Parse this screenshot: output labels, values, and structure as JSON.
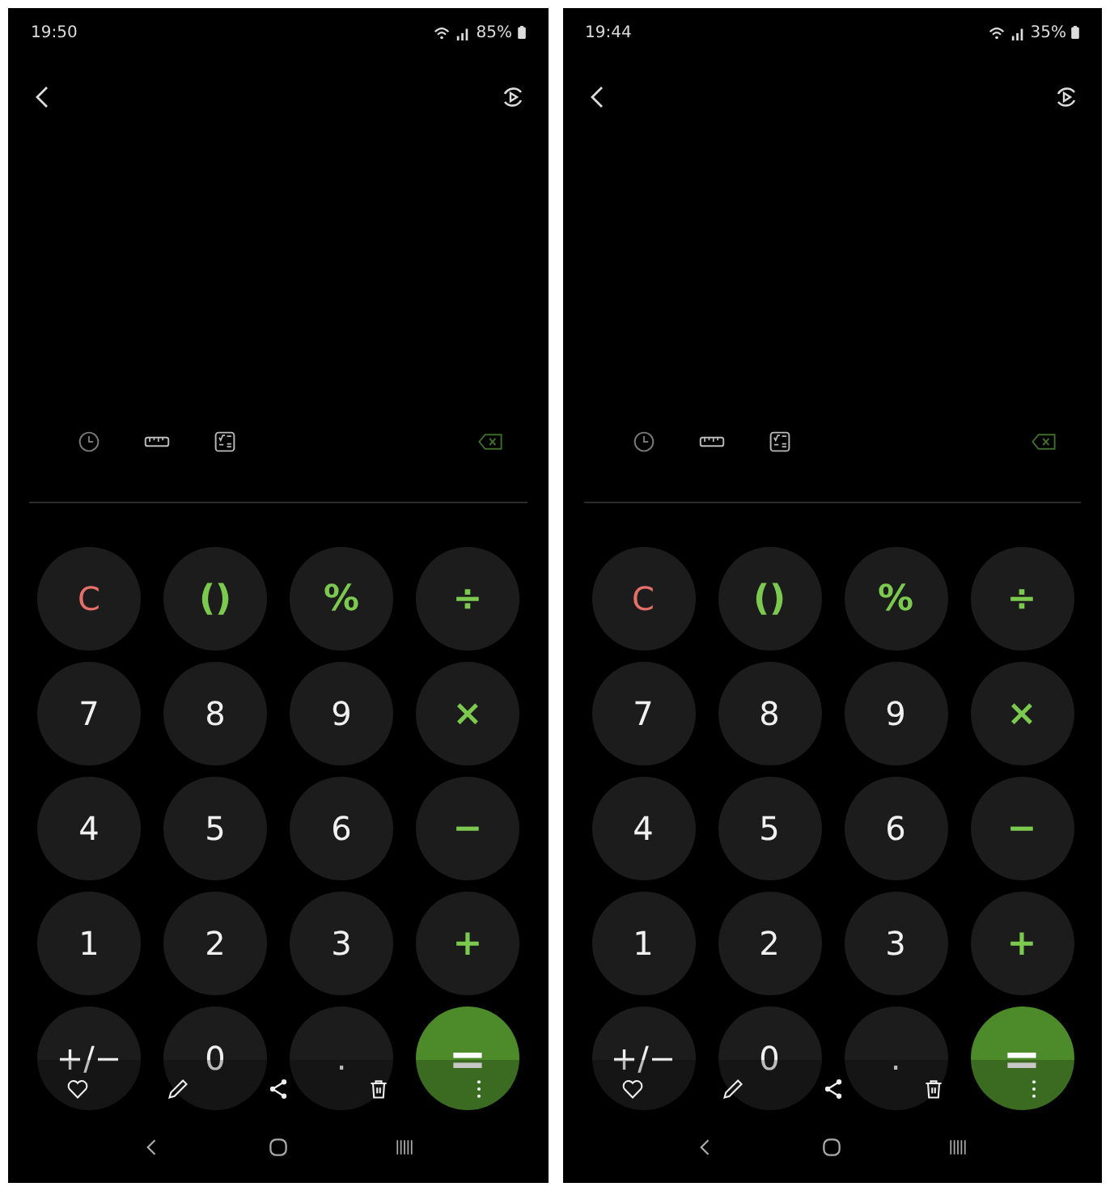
{
  "screens": [
    {
      "status_bar": {
        "time": "19:50",
        "battery": "85%"
      },
      "keys": [
        {
          "label": "C",
          "kind": "clear"
        },
        {
          "label": "()",
          "kind": "op"
        },
        {
          "label": "%",
          "kind": "op"
        },
        {
          "label": "÷",
          "kind": "op"
        },
        {
          "label": "7",
          "kind": "digit"
        },
        {
          "label": "8",
          "kind": "digit"
        },
        {
          "label": "9",
          "kind": "digit"
        },
        {
          "label": "×",
          "kind": "op"
        },
        {
          "label": "4",
          "kind": "digit"
        },
        {
          "label": "5",
          "kind": "digit"
        },
        {
          "label": "6",
          "kind": "digit"
        },
        {
          "label": "−",
          "kind": "op"
        },
        {
          "label": "1",
          "kind": "digit"
        },
        {
          "label": "2",
          "kind": "digit"
        },
        {
          "label": "3",
          "kind": "digit"
        },
        {
          "label": "+",
          "kind": "op"
        },
        {
          "label": "+/−",
          "kind": "digit"
        },
        {
          "label": "0",
          "kind": "digit"
        },
        {
          "label": ".",
          "kind": "digit"
        },
        {
          "label": "=",
          "kind": "equals"
        }
      ]
    },
    {
      "status_bar": {
        "time": "19:44",
        "battery": "35%"
      },
      "keys": [
        {
          "label": "C",
          "kind": "clear"
        },
        {
          "label": "()",
          "kind": "op"
        },
        {
          "label": "%",
          "kind": "op"
        },
        {
          "label": "÷",
          "kind": "op"
        },
        {
          "label": "7",
          "kind": "digit"
        },
        {
          "label": "8",
          "kind": "digit"
        },
        {
          "label": "9",
          "kind": "digit"
        },
        {
          "label": "×",
          "kind": "op"
        },
        {
          "label": "4",
          "kind": "digit"
        },
        {
          "label": "5",
          "kind": "digit"
        },
        {
          "label": "6",
          "kind": "digit"
        },
        {
          "label": "−",
          "kind": "op"
        },
        {
          "label": "1",
          "kind": "digit"
        },
        {
          "label": "2",
          "kind": "digit"
        },
        {
          "label": "3",
          "kind": "digit"
        },
        {
          "label": "+",
          "kind": "op"
        },
        {
          "label": "+/−",
          "kind": "digit"
        },
        {
          "label": "0",
          "kind": "digit"
        },
        {
          "label": ".",
          "kind": "digit"
        },
        {
          "label": "=",
          "kind": "equals"
        }
      ]
    }
  ]
}
